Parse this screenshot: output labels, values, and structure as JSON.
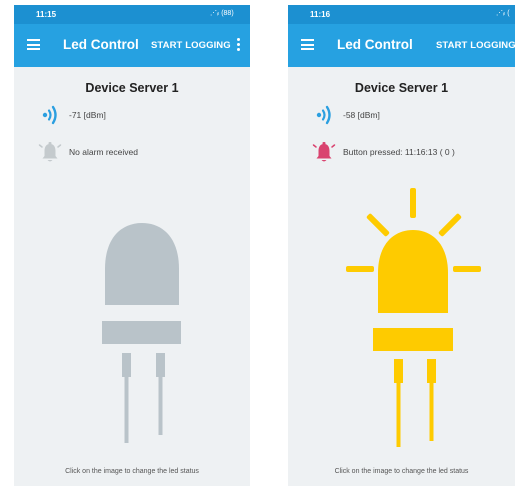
{
  "screens": [
    {
      "status_time": "11:15",
      "status_icons": "⋰ᵢₗ (88)",
      "app_title": "Led Control",
      "start_logging_label": "START LOGGING",
      "device_title": "Device Server 1",
      "signal_text": "-71 [dBm]",
      "alarm_text": "No alarm received",
      "alarm_active": false,
      "led_on": false,
      "led_color": "#b9c3c9",
      "footer_text": "Click on the image to change the led status"
    },
    {
      "status_time": "11:16",
      "status_icons": "⋰ᵢₗ (",
      "app_title": "Led Control",
      "start_logging_label": "START LOGGING",
      "device_title": "Device Server 1",
      "signal_text": "-58 [dBm]",
      "alarm_text": "Button pressed: 11:16:13 ( 0 )",
      "alarm_active": true,
      "led_on": true,
      "led_color": "#fecb00",
      "footer_text": "Click on the image to change the led status"
    }
  ],
  "colors": {
    "status_bar": "#1c90d1",
    "app_bar": "#26a1e1",
    "background": "#eef1f3",
    "signal_icon": "#2b9fe0",
    "bell_inactive": "#c4cacd",
    "bell_active": "#d9436f"
  },
  "icons": {
    "menu": "hamburger-menu-icon",
    "overflow": "more-vertical-icon",
    "signal": "wifi-signal-icon",
    "alarm": "bell-icon"
  }
}
